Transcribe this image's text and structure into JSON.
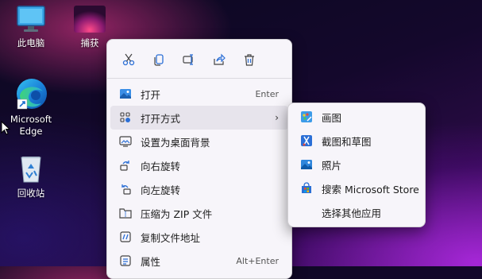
{
  "desktop": {
    "icons": [
      {
        "label": "此电脑"
      },
      {
        "label": "捕获"
      },
      {
        "label": "Microsoft Edge"
      },
      {
        "label": "回收站"
      }
    ]
  },
  "context_menu": {
    "toolbar": [
      "cut-icon",
      "copy-icon",
      "rename-icon",
      "share-icon",
      "delete-icon"
    ],
    "items": [
      {
        "label": "打开",
        "shortcut": "Enter"
      },
      {
        "label": "打开方式"
      },
      {
        "label": "设置为桌面背景"
      },
      {
        "label": "向右旋转"
      },
      {
        "label": "向左旋转"
      },
      {
        "label": "压缩为 ZIP 文件"
      },
      {
        "label": "复制文件地址"
      },
      {
        "label": "属性",
        "shortcut": "Alt+Enter"
      }
    ]
  },
  "submenu": {
    "items": [
      {
        "label": "画图"
      },
      {
        "label": "截图和草图"
      },
      {
        "label": "照片"
      },
      {
        "label": "搜索 Microsoft Store"
      },
      {
        "label": "选择其他应用"
      }
    ]
  },
  "colors": {
    "accent": "#2b6fd6",
    "menu_bg": "#f7f5fa",
    "hover": "#e7e4ec"
  }
}
